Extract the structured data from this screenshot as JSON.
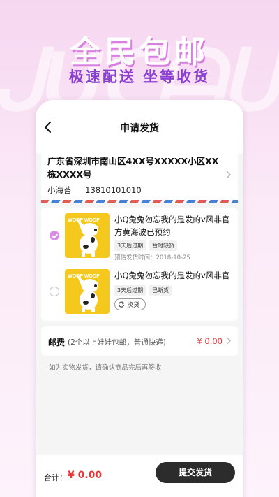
{
  "hero": {
    "title": "全民包邮",
    "subtitle": "极速配送 坐等收货"
  },
  "navbar": {
    "title": "申请发货"
  },
  "address": {
    "text": "广东省深圳市南山区4XX号XXXXX小区XX栋XXXX号",
    "name": "小海苔",
    "phone": "13810101010"
  },
  "goods": [
    {
      "checked": true,
      "title": "小Q兔兔勿忘我的是发的v风非官方黄海波已预约",
      "tags": [
        "3天后过期",
        "暂时缺货"
      ],
      "date": "预估发货时间：2018-10-25",
      "thumb_text": "WOOF WOOF"
    },
    {
      "checked": false,
      "title": "小Q兔兔勿忘我的是发的v风非官",
      "tags": [
        "3天后过期",
        "已断货"
      ],
      "swap_label": "换货",
      "thumb_text": "WOOF WOOF"
    }
  ],
  "shipping": {
    "label": "邮费",
    "note": "(2个以上娃娃包邮，普通快递)",
    "price": "¥ 0.00"
  },
  "hint": "如为实物发货，请确认商品完后再签收",
  "footer": {
    "total_label": "合计：",
    "total_value": "¥ 0.00",
    "submit_label": "提交发货"
  },
  "colors": {
    "accent": "#d98be6",
    "price": "#e53935",
    "button": "#2c2c2c"
  }
}
